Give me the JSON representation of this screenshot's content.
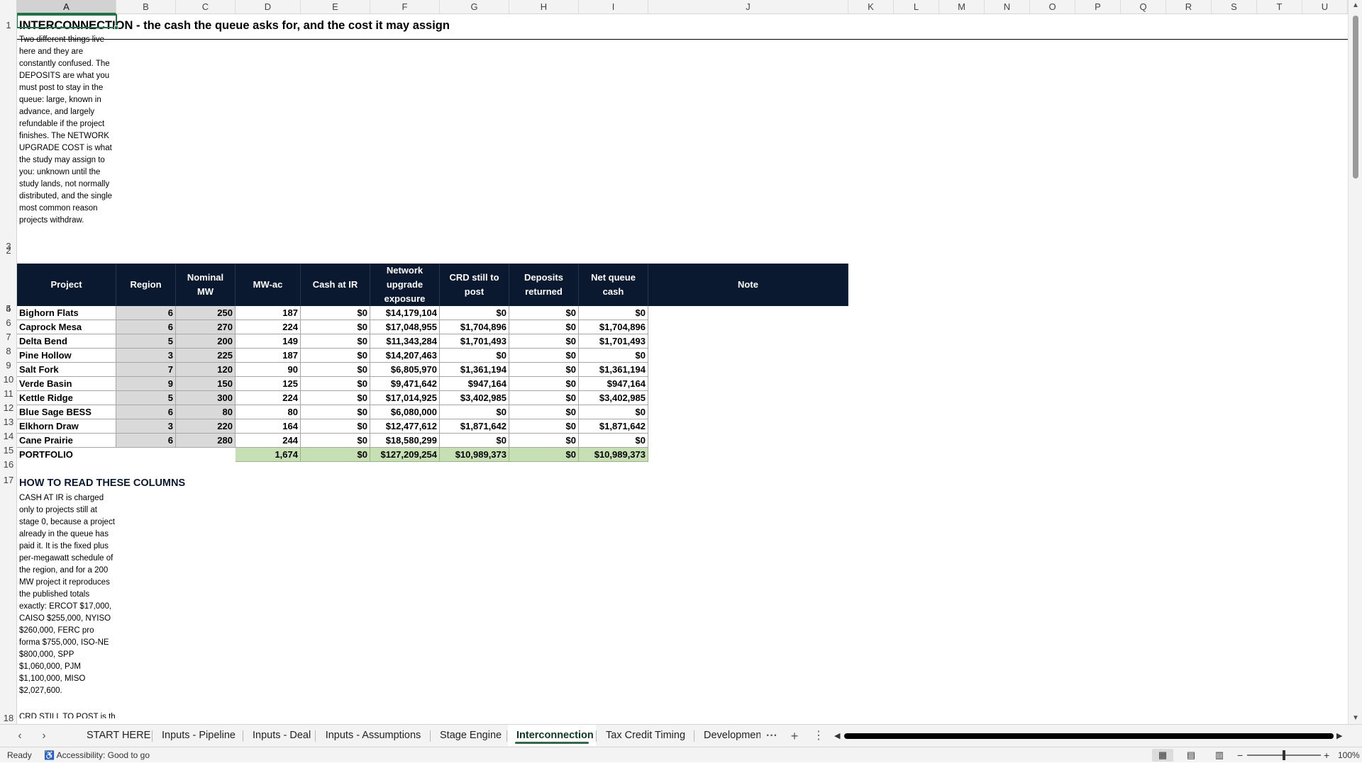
{
  "columns": [
    "A",
    "B",
    "C",
    "D",
    "E",
    "F",
    "G",
    "H",
    "I",
    "J",
    "K",
    "L",
    "M",
    "N",
    "O",
    "P",
    "Q",
    "R",
    "S",
    "T",
    "U"
  ],
  "row_numbers": [
    "1",
    "2",
    "3",
    "4",
    "5",
    "6",
    "7",
    "8",
    "9",
    "10",
    "11",
    "12",
    "13",
    "14",
    "15",
    "16",
    "17",
    "18"
  ],
  "sheet": {
    "title": "INTERCONNECTION - the cash the queue asks for, and the cost it may assign",
    "intro_text": "Two different things live here and they are constantly confused. The DEPOSITS are what you must post to stay in the queue: large, known in advance, and largely refundable if the project finishes. The NETWORK UPGRADE COST is what the study may assign to you: unknown until the study lands, not normally distributed, and the single most common reason projects withdraw.",
    "section2_heading": "HOW TO READ THESE COLUMNS",
    "section2_text": "CASH AT IR is charged only to projects still at stage 0, because a project already in the queue has paid it. It is the fixed plus per-megawatt schedule of the region, and for a 200 MW project it reproduces the published totals exactly: ERCOT $17,000, CAISO $255,000, NYISO $260,000, FERC pro forma $755,000, ISO-NE $800,000, SPP $1,060,000, PJM $1,100,000, MISO $2,027,600.",
    "section2_cutoff": "CRD STILL TO POST is th"
  },
  "table": {
    "headers": [
      "Project",
      "Region",
      "Nominal MW",
      "MW-ac",
      "Cash at IR",
      "Network upgrade exposure",
      "CRD still to post",
      "Deposits returned",
      "Net queue cash",
      "Note"
    ],
    "rows": [
      [
        "Bighorn Flats",
        "6",
        "250",
        "187",
        "$0",
        "$14,179,104",
        "$0",
        "$0",
        "$0",
        ""
      ],
      [
        "Caprock Mesa",
        "6",
        "270",
        "224",
        "$0",
        "$17,048,955",
        "$1,704,896",
        "$0",
        "$1,704,896",
        ""
      ],
      [
        "Delta Bend",
        "5",
        "200",
        "149",
        "$0",
        "$11,343,284",
        "$1,701,493",
        "$0",
        "$1,701,493",
        ""
      ],
      [
        "Pine Hollow",
        "3",
        "225",
        "187",
        "$0",
        "$14,207,463",
        "$0",
        "$0",
        "$0",
        ""
      ],
      [
        "Salt Fork",
        "7",
        "120",
        "90",
        "$0",
        "$6,805,970",
        "$1,361,194",
        "$0",
        "$1,361,194",
        ""
      ],
      [
        "Verde Basin",
        "9",
        "150",
        "125",
        "$0",
        "$9,471,642",
        "$947,164",
        "$0",
        "$947,164",
        ""
      ],
      [
        "Kettle Ridge",
        "5",
        "300",
        "224",
        "$0",
        "$17,014,925",
        "$3,402,985",
        "$0",
        "$3,402,985",
        ""
      ],
      [
        "Blue Sage BESS",
        "6",
        "80",
        "80",
        "$0",
        "$6,080,000",
        "$0",
        "$0",
        "$0",
        ""
      ],
      [
        "Elkhorn Draw",
        "3",
        "220",
        "164",
        "$0",
        "$12,477,612",
        "$1,871,642",
        "$0",
        "$1,871,642",
        ""
      ],
      [
        "Cane Prairie",
        "6",
        "280",
        "244",
        "$0",
        "$18,580,299",
        "$0",
        "$0",
        "$0",
        ""
      ]
    ],
    "total_row": {
      "label": "PORTFOLIO",
      "mw_ac": "1,674",
      "cash_at_ir": "$0",
      "network_upgrade": "$127,209,254",
      "crd": "$10,989,373",
      "deposits_returned": "$0",
      "net_queue_cash": "$10,989,373"
    }
  },
  "tabs": [
    "START HERE",
    "Inputs - Pipeline",
    "Inputs - Deal",
    "Inputs - Assumptions",
    "Stage Engine",
    "Interconnection",
    "Tax Credit Timing",
    "Development"
  ],
  "active_tab": "Interconnection",
  "tab_overflow": "···",
  "add_sheet": "+",
  "tab_menu": "⋮",
  "status": {
    "ready": "Ready",
    "accessibility": "Accessibility: Good to go",
    "zoom": "100%"
  },
  "colors": {
    "header_fill": "#0b1930",
    "input_fill": "#d9d9d9",
    "total_fill": "#c6e0b4",
    "accent": "#217346"
  }
}
